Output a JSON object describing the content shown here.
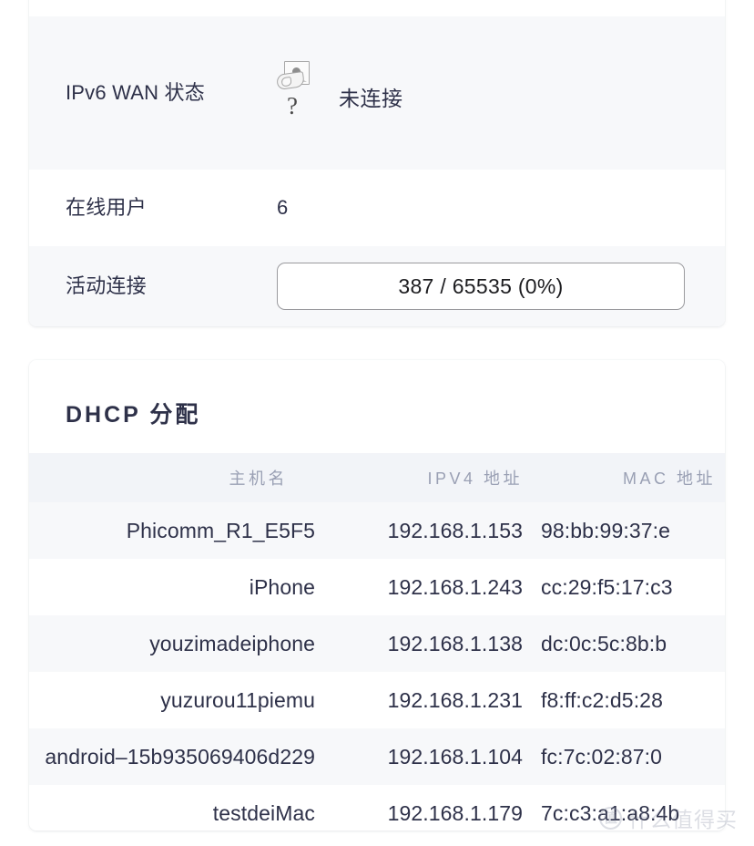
{
  "status_card": {
    "rows": [
      {
        "label": "IPv6 WAN 状态",
        "icon": "broken-image-icon",
        "icon_qmark": "?",
        "value": "未连接"
      },
      {
        "label": "在线用户",
        "value": "6"
      },
      {
        "label": "活动连接",
        "value": "387 / 65535 (0%)",
        "progress_percent": 0,
        "current": 387,
        "max": 65535
      }
    ]
  },
  "dhcp_card": {
    "title": "DHCP 分配",
    "columns": [
      "主机名",
      "IPV4 地址",
      "MAC 地址"
    ],
    "rows": [
      {
        "hostname": "Phicomm_R1_E5F5",
        "ipv4": "192.168.1.153",
        "mac": "98:bb:99:37:e"
      },
      {
        "hostname": "iPhone",
        "ipv4": "192.168.1.243",
        "mac": "cc:29:f5:17:c3"
      },
      {
        "hostname": "youzimadeiphone",
        "ipv4": "192.168.1.138",
        "mac": "dc:0c:5c:8b:b"
      },
      {
        "hostname": "yuzurou11piemu",
        "ipv4": "192.168.1.231",
        "mac": "f8:ff:c2:d5:28"
      },
      {
        "hostname": "android–15b935069406d229",
        "ipv4": "192.168.1.104",
        "mac": "fc:7c:02:87:0"
      },
      {
        "hostname": "testdeiMac",
        "ipv4": "192.168.1.179",
        "mac": "7c:c3:a1:a8:4b"
      }
    ]
  },
  "watermark": {
    "badge": "值",
    "text": "什么值得买"
  },
  "colors": {
    "page_background": "#ffffff",
    "card_background": "#ffffff",
    "row_shaded": "#f7f8fa",
    "table_header_background": "#f2f4f8",
    "text_primary": "#2e3149",
    "text_muted": "#9aa0b4"
  }
}
